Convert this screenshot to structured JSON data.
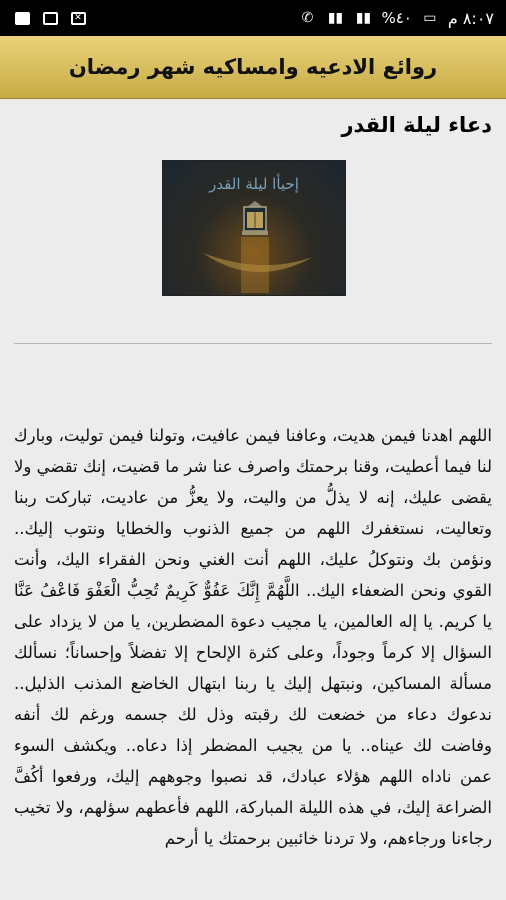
{
  "status_bar": {
    "time": "٨:٠٧ م",
    "battery": "%٤٠"
  },
  "app": {
    "title": "روائع الادعيه وامساكيه شهر رمضان"
  },
  "article": {
    "heading": "دعاء ليلة القدر",
    "image_caption": "إحيأا ليلة القدر",
    "body": "اللهم اهدنا فيمن هديت، وعافنا فيمن عافيت، وتولنا فيمن توليت، وبارك لنا فيما أعطيت، وقنا برحمتك واصرف عنا شر ما قضيت، إنك تقضي ولا يقضى عليك، إنه لا يذلُّ من واليت، ولا يعزُّ من عاديت، تباركت ربنا وتعاليت، نستغفرك اللهم من جميع الذنوب والخطايا ونتوب إليك.. ونؤمن بك ونتوكلُ عليك، اللهم أنت الغني ونحن الفقراء اليك، وأنت القوي ونحن الضعفاء اليك.. اللَّهُمَّ إِنَّكَ عَفُوٌّ كَرِيمٌ تُحِبُّ الْعَفْوَ فَاعْفُ عَنَّا يا كريم. يا إله العالمين، يا مجيب دعوة المضطرين، يا من لا يزداد على السؤال إلا كرماً وجوداً، وعلى كثرة الإلحاح إلا تفضلاً وإحساناً؛ نسألك مسألة المساكين، ونبتهل إليك يا ربنا ابتهال الخاضع المذنب الذليل.. ندعوك دعاء من خضعت لك رقبته وذل لك جسمه ورغم لك أنفه وفاضت لك عيناه.. يا من يجيب المضطر إذا دعاه.. ويكشف السوء عمن ناداه اللهم هؤلاء عبادك، قد نصبوا وجوههم إليك، ورفعوا أكُفَّ الضراعة إليك، في هذه الليلة المباركة، اللهم فأعطهم سؤلهم، ولا تخيب رجاءنا ورجاءهم، ولا تردنا خائبين برحمتك يا أرحم"
  }
}
